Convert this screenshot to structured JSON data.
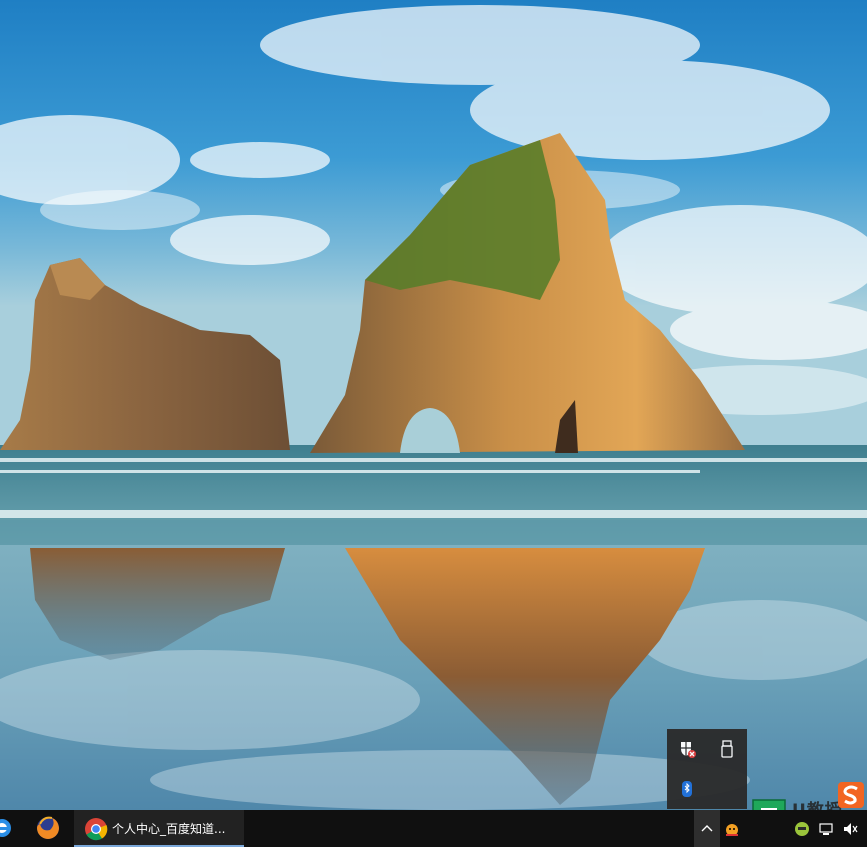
{
  "taskbar": {
    "pinned": [
      {
        "name": "edge-icon"
      },
      {
        "name": "firefox-icon"
      }
    ],
    "window_button": {
      "icon": "chrome-icon",
      "title": "个人中心_百度知道..."
    }
  },
  "tray": {
    "overflow_icons": [
      "security-shield-icon",
      "usb-drive-icon",
      "bluetooth-icon"
    ],
    "visible_icons": [
      "input-method-icon",
      "app-icon",
      "network-icon",
      "speaker-icon"
    ]
  },
  "watermark": {
    "text": "U教授",
    "logo": "sogou-s-icon"
  },
  "colors": {
    "taskbar": "#101010",
    "flyout": "#2b2b2b",
    "accent": "#7aa7d9"
  }
}
